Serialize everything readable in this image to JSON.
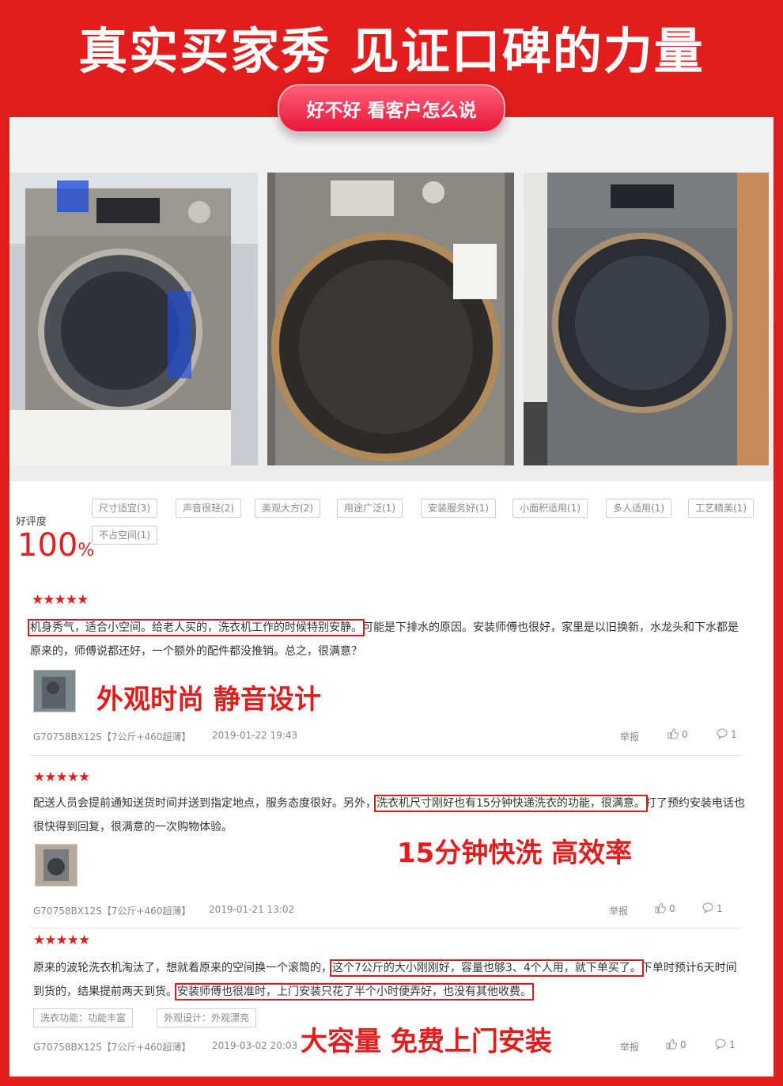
{
  "header": {
    "title": "真实买家秀  见证口碑的力量",
    "pill": "好不好 看客户怎么说"
  },
  "rating": {
    "label": "好评度",
    "value": "100",
    "unit": "%"
  },
  "tags": [
    "尺寸适宜(3)",
    "声音很轻(2)",
    "美观大方(2)",
    "用途广泛(1)",
    "安装服务好(1)",
    "小面积适用(1)",
    "多人适用(1)",
    "工艺精美(1)",
    "不占空间(1)"
  ],
  "reviews": [
    {
      "stars": "★★★★★",
      "highlight": "机身秀气，适合小空间。给老人买的，洗衣机工作的时候特别安静。",
      "text_after": "可能是下排水的原因。安装师傅也很好，家里是以旧换新，水龙头和下水都是原来的，师傅说都还好，一个额外的配件都没推销。总之，很满意？",
      "callout": "外观时尚 静音设计",
      "model": "G70758BX12S【7公斤+460超薄】",
      "date": "2019-01-22 19:43",
      "report": "举报",
      "likes": "0",
      "comments": "1"
    },
    {
      "stars": "★★★★★",
      "text_before": "配送人员会提前通知送货时间并送到指定地点，服务态度很好。另外，",
      "highlight": "洗衣机尺寸刚好也有15分钟快递洗衣的功能，很满意。",
      "text_after": "打了预约安装电话也很快得到回复，很满意的一次购物体验。",
      "callout": "15分钟快洗 高效率",
      "model": "G70758BX12S【7公斤+460超薄】",
      "date": "2019-01-21 13:02",
      "report": "举报",
      "likes": "0",
      "comments": "1"
    },
    {
      "stars": "★★★★★",
      "text_before": "原来的波轮洗衣机淘汰了，想就着原来的空间换一个滚筒的，",
      "highlight": "这个7公斤的大小刚刚好，容量也够3、4个人用，就下单买了。",
      "text_mid": "下单时预计6天时间到货的，结果提前两天到货。",
      "highlight2": "安装师傅也很准时，上门安装只花了半个小时便弄好，也没有其他收费。",
      "tag1": "洗衣功能：功能丰富",
      "tag2": "外观设计：外观漂亮",
      "callout": "大容量 免费上门安装",
      "model": "G70758BX12S【7公斤+460超薄】",
      "date": "2019-03-02 20:03",
      "report": "举报",
      "likes": "0",
      "comments": "1"
    }
  ],
  "colors": {
    "brand_red": "#e11d1d",
    "highlight_border": "#d21f1f"
  },
  "icons": [
    "thumbs-up-icon",
    "comment-icon",
    "star-icon"
  ]
}
